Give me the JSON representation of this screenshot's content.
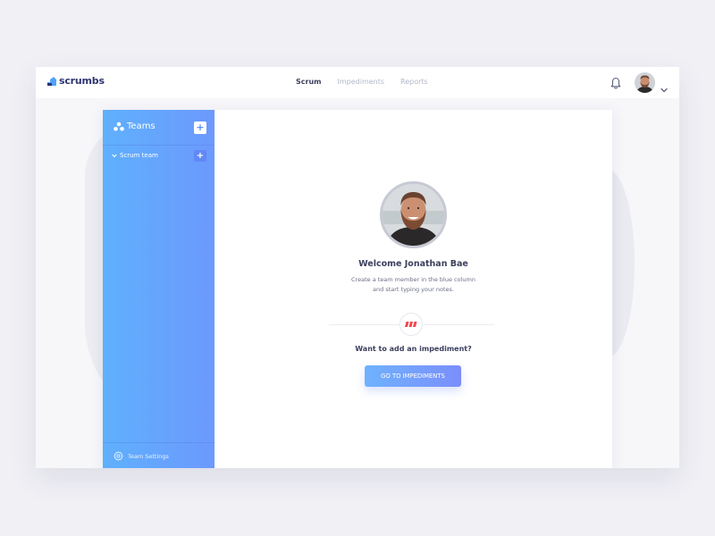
{
  "app": {
    "brand": "scrumbs",
    "brand_color": "#2f3572",
    "accent_colors": {
      "sidebar_gradient_start": "#5fb0fd",
      "sidebar_gradient_end": "#6c99fd",
      "impediment_red": "#f0484f"
    }
  },
  "topbar": {
    "nav": [
      {
        "label": "Scrum",
        "active": true
      },
      {
        "label": "Impediments",
        "active": false
      },
      {
        "label": "Reports",
        "active": false
      }
    ],
    "icons": {
      "notifications": "bell-icon",
      "profile_menu": "chevron-down-icon"
    }
  },
  "sidebar": {
    "title": "Teams",
    "title_icon": "teams-icon",
    "add_label": "+",
    "teams": [
      {
        "name": "Scrum team",
        "expanded": true,
        "add_label": "+"
      }
    ],
    "footer": {
      "label": "Team Settings",
      "icon": "gear-icon"
    }
  },
  "main": {
    "welcome_title": "Welcome Jonathan Bae",
    "welcome_text_line1": "Create a team member in the blue column",
    "welcome_text_line2": "and start typing your notes.",
    "impediment_question": "Want to add an impediment?",
    "cta_label": "GO TO IMPEDIMENTS"
  }
}
